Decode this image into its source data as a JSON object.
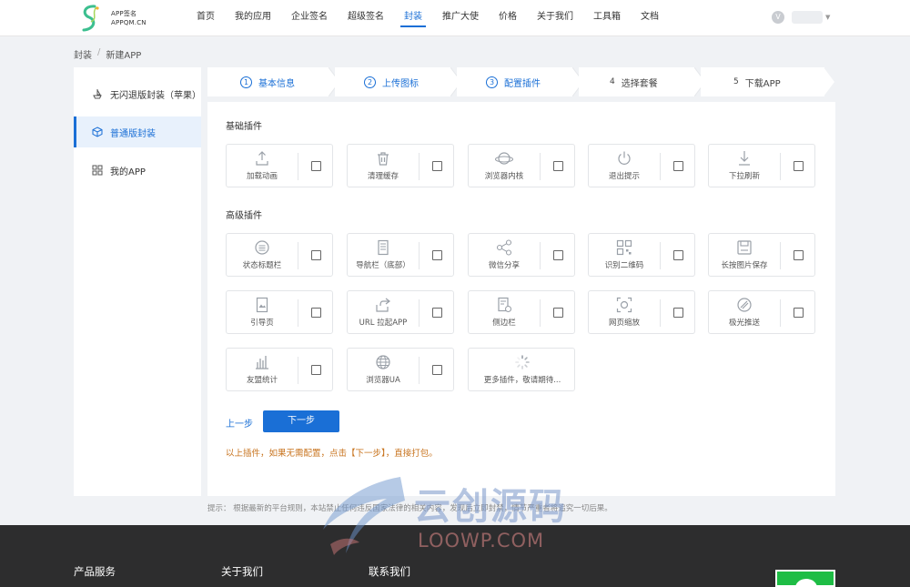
{
  "header": {
    "logo_line1": "APP签名",
    "logo_line2": "APPQM.CN",
    "nav": [
      {
        "label": "首页",
        "active": false
      },
      {
        "label": "我的应用",
        "active": false
      },
      {
        "label": "企业签名",
        "active": false
      },
      {
        "label": "超级签名",
        "active": false
      },
      {
        "label": "封装",
        "active": true
      },
      {
        "label": "推广大使",
        "active": false
      },
      {
        "label": "价格",
        "active": false
      },
      {
        "label": "关于我们",
        "active": false
      },
      {
        "label": "工具箱",
        "active": false
      },
      {
        "label": "文档",
        "active": false
      }
    ],
    "vip_icon": "V"
  },
  "breadcrumb": {
    "root": "封装",
    "sep": "/",
    "current": "新建APP"
  },
  "sidebar": {
    "items": [
      {
        "label": "无闪退版封装（苹果）",
        "icon": "ship-icon",
        "active": false
      },
      {
        "label": "普通版封装",
        "icon": "cube-icon",
        "active": true
      },
      {
        "label": "我的APP",
        "icon": "grid-icon",
        "active": false
      }
    ]
  },
  "steps": [
    {
      "num": "1",
      "label": "基本信息",
      "done": true
    },
    {
      "num": "2",
      "label": "上传图标",
      "done": true
    },
    {
      "num": "3",
      "label": "配置插件",
      "done": true
    },
    {
      "num": "4",
      "label": "选择套餐",
      "done": false
    },
    {
      "num": "5",
      "label": "下载APP",
      "done": false
    }
  ],
  "basic": {
    "title": "基础插件",
    "plugins": [
      {
        "label": "加载动画",
        "icon": "upload-icon",
        "checked": false
      },
      {
        "label": "清理缓存",
        "icon": "trash-icon",
        "checked": false
      },
      {
        "label": "浏览器内核",
        "icon": "planet-icon",
        "checked": false
      },
      {
        "label": "退出提示",
        "icon": "power-icon",
        "checked": false
      },
      {
        "label": "下拉刷新",
        "icon": "pull-down-icon",
        "checked": false
      }
    ]
  },
  "advanced": {
    "title": "高级插件",
    "plugins": [
      {
        "label": "状态标题栏",
        "icon": "status-bar-icon",
        "checked": false
      },
      {
        "label": "导航栏（底部）",
        "icon": "nav-bar-icon",
        "checked": false
      },
      {
        "label": "微信分享",
        "icon": "share-icon",
        "checked": false
      },
      {
        "label": "识别二维码",
        "icon": "qrcode-icon",
        "checked": false
      },
      {
        "label": "长按图片保存",
        "icon": "save-icon",
        "checked": false
      },
      {
        "label": "引导页",
        "icon": "guide-page-icon",
        "checked": false
      },
      {
        "label": "URL 拉起APP",
        "icon": "launch-icon",
        "checked": false
      },
      {
        "label": "侧边栏",
        "icon": "sidebar-icon",
        "checked": false
      },
      {
        "label": "网页缩放",
        "icon": "zoom-icon",
        "checked": false
      },
      {
        "label": "极光推送",
        "icon": "push-icon",
        "checked": false
      },
      {
        "label": "友盟统计",
        "icon": "stats-icon",
        "checked": false
      },
      {
        "label": "浏览器UA",
        "icon": "globe-icon",
        "checked": false
      }
    ],
    "more_label": "更多插件，敬请期待..."
  },
  "actions": {
    "prev_label": "上一步",
    "next_label": "下一步"
  },
  "hint": "以上插件，如果无需配置，点击【下一步】，直接打包。",
  "notice": "提示：  根据最新的平台规则，本站禁止任何违反国家法律的相关内容，发现后立即封禁，情节严重者将追究一切后果。",
  "watermark": {
    "cn": "云创源码",
    "en": "LOOWP.COM"
  },
  "footer": {
    "cols": [
      "产品服务",
      "关于我们",
      "联系我们"
    ]
  },
  "colors": {
    "accent": "#1a6fd6",
    "hint": "#c8741f",
    "footer": "#2d2d2e"
  }
}
